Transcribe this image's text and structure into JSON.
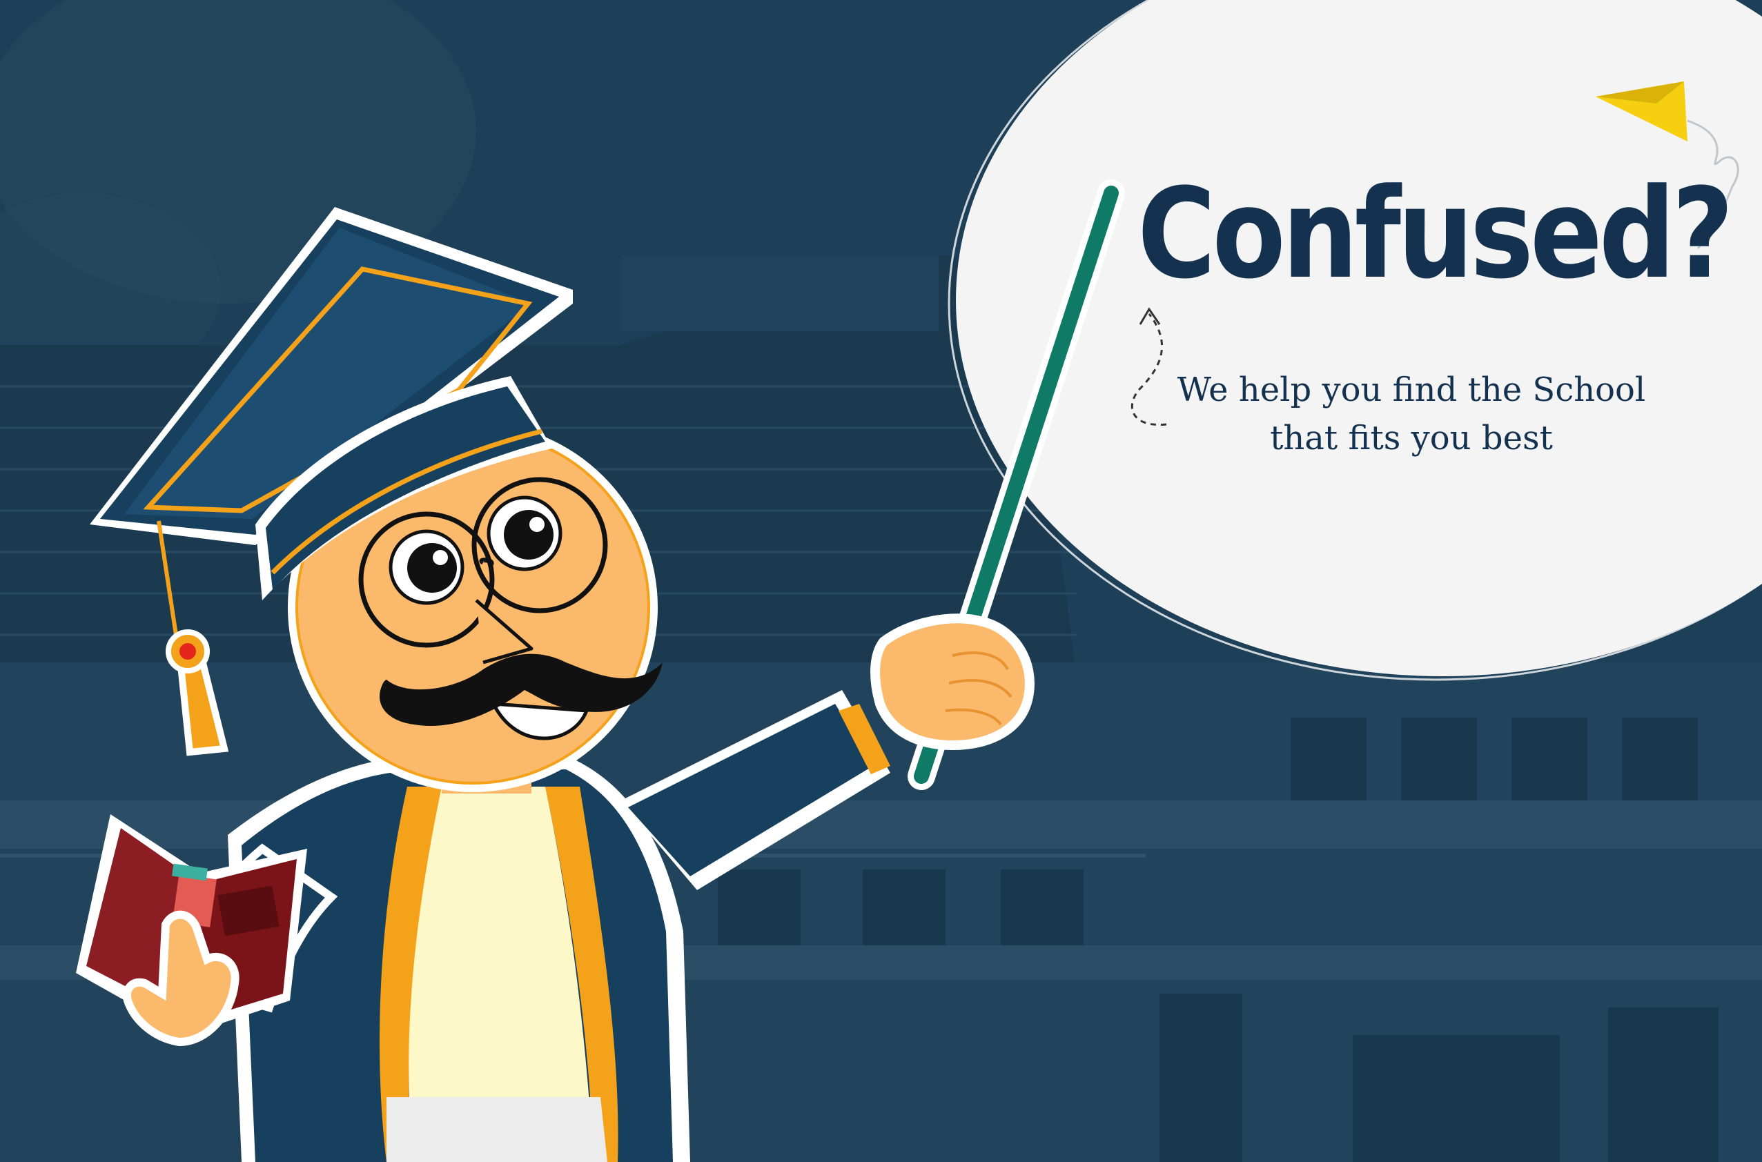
{
  "banner": {
    "headline": "Confused?",
    "tagline_line1": "We help you find the School",
    "tagline_line2": "that fits you best"
  },
  "colors": {
    "background": "#1d3f57",
    "bubble": "#f4f4f4",
    "headline_text": "#14324f",
    "gown": "#17405f",
    "trim": "#f5a21b",
    "face": "#fbb96c",
    "pointer": "#0f7a66",
    "book": "#8c1d22",
    "paper_plane": "#f5cf10"
  },
  "icons": {
    "plane": "paper-plane-icon",
    "arrow": "curved-arrow-icon"
  }
}
